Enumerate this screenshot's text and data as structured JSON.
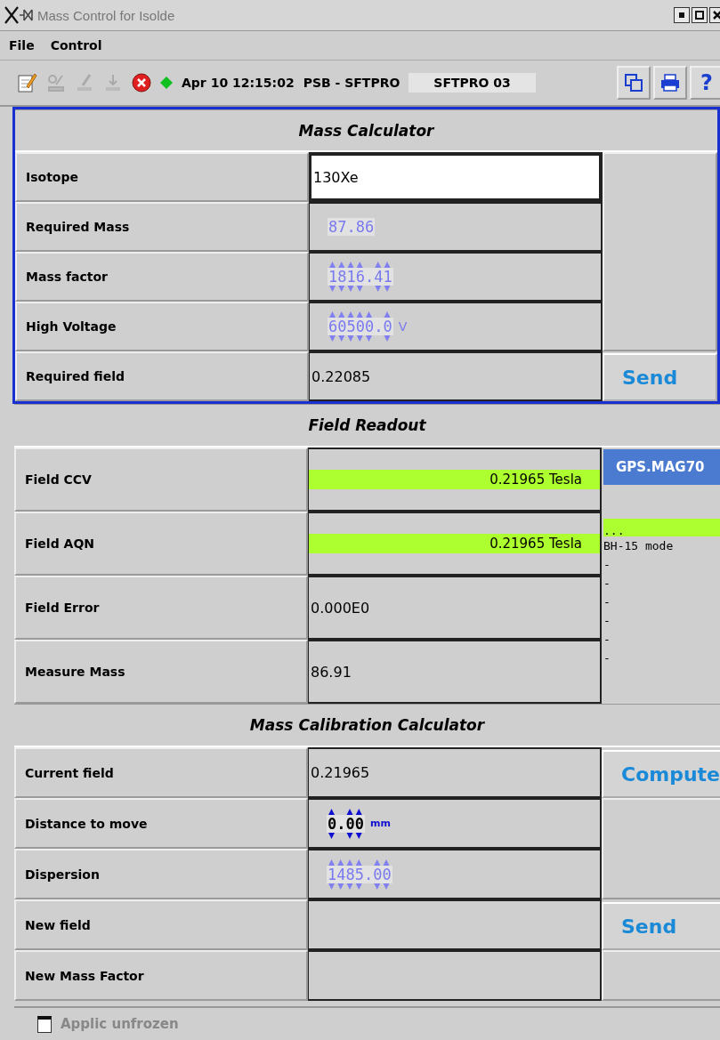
{
  "window": {
    "title": "Mass Control for Isolde"
  },
  "menu": [
    "File",
    "Control"
  ],
  "toolbar": {
    "timestamp": "Apr 10 12:15:02",
    "context": "PSB - SFTPRO",
    "user": "SFTPRO 03",
    "help": "?",
    "running": true
  },
  "mass_calculator": {
    "title": "Mass Calculator",
    "button": "Send",
    "rows": [
      {
        "label": "Isotope",
        "kind": "input",
        "value": "130Xe"
      },
      {
        "label": "Required Mass",
        "kind": "spinner",
        "value": "87.86",
        "enabled": false,
        "arrows": false
      },
      {
        "label": "Mass factor",
        "kind": "spinner",
        "value": "1816.41",
        "enabled": false,
        "arrows": true
      },
      {
        "label": "High Voltage",
        "kind": "spinner",
        "value": "60500.0",
        "unit": "V",
        "enabled": false,
        "arrows": true
      },
      {
        "label": "Required field",
        "kind": "text",
        "value": "0.22085"
      }
    ]
  },
  "field_readout": {
    "title": "Field Readout",
    "rows": [
      {
        "label": "Field CCV",
        "kind": "reading",
        "value": "0.21965 Tesla",
        "highlighted": true
      },
      {
        "label": "Field AQN",
        "kind": "reading",
        "value": "0.21965 Tesla",
        "highlighted": true
      },
      {
        "label": "Field Error",
        "kind": "text",
        "value": "0.000E0"
      },
      {
        "label": "Measure Mass",
        "kind": "text",
        "value": "86.91"
      }
    ],
    "side": {
      "device": "GPS.MAG70",
      "status": "...",
      "status_highlighted": true,
      "lines": [
        "BH-15 mode",
        "-",
        "-",
        "-",
        "-",
        "-",
        "-"
      ]
    }
  },
  "calibration": {
    "title": "Mass Calibration Calculator",
    "compute_button": "Compute",
    "send_button": "Send",
    "rows": [
      {
        "label": "Current field",
        "kind": "text",
        "value": "0.21965"
      },
      {
        "label": "Distance to move",
        "kind": "spinner",
        "value": "0.00",
        "unit": "mm",
        "enabled": true,
        "arrows": true
      },
      {
        "label": "Dispersion",
        "kind": "spinner",
        "value": "1485.00",
        "enabled": false,
        "arrows": true
      },
      {
        "label": "New field",
        "kind": "empty"
      },
      {
        "label": "New Mass Factor",
        "kind": "empty"
      }
    ]
  },
  "status_bar": {
    "text": "Applic unfrozen",
    "checked": false
  }
}
